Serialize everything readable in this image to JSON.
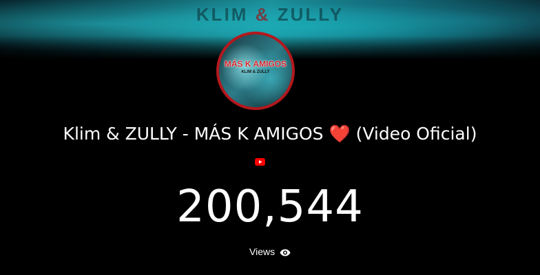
{
  "banner": {
    "text_left": "KLIM",
    "text_amp": "&",
    "text_right": "ZULLY"
  },
  "avatar": {
    "title": "MÁS K AMIGOS",
    "subtitle": "KLIM & ZULLY"
  },
  "video": {
    "title_main": "Klim & ZULLY - MÁS K AMIGOS",
    "title_emoji": "❤️",
    "title_suffix": "(Video Oficial)",
    "platform_icon": "youtube-icon"
  },
  "stats": {
    "views_count": "200,544",
    "views_label": "Views",
    "views_icon": "eye-icon"
  },
  "colors": {
    "background": "#000000",
    "accent_red": "#b3181d",
    "youtube_red": "#ff0000",
    "banner_teal": "#1a8f99"
  }
}
